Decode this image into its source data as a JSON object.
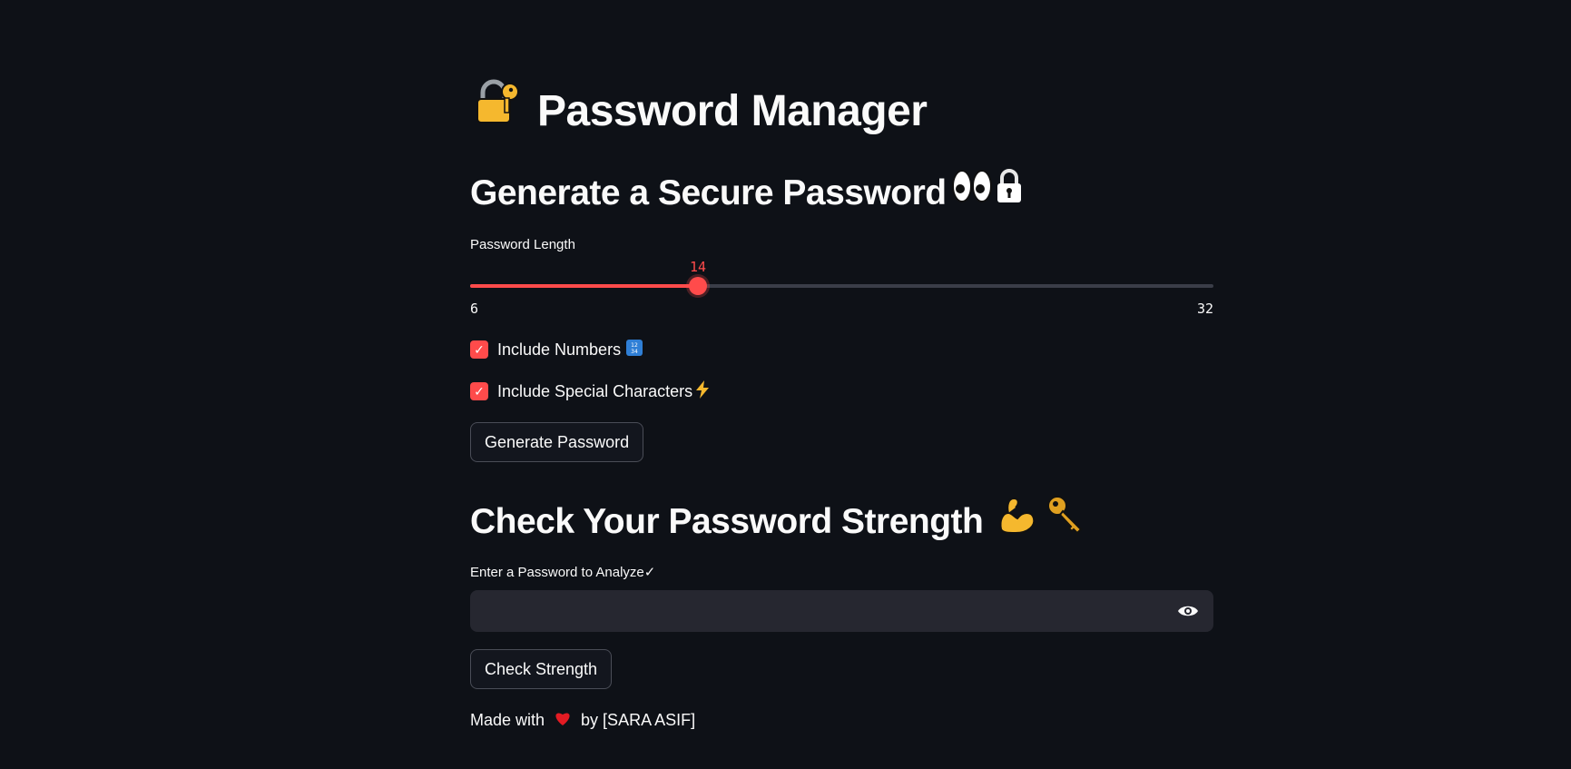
{
  "app": {
    "title": "Password Manager",
    "title_icon": "locked-with-key-icon"
  },
  "generator": {
    "heading": "Generate a Secure Password",
    "heading_icons": [
      "eyes-icon",
      "padlock-icon"
    ],
    "length_label": "Password Length",
    "length": {
      "min": "6",
      "max": "32",
      "value": "14"
    },
    "include_numbers": {
      "label": "Include Numbers",
      "icon": "numbers-keycap-icon",
      "checked": true
    },
    "include_special": {
      "label": "Include Special Characters",
      "icon": "lightning-icon",
      "checked": true
    },
    "button_label": "Generate Password"
  },
  "checker": {
    "heading": "Check Your Password Strength",
    "heading_icons": [
      "flexed-biceps-icon",
      "key-icon"
    ],
    "input_label": "Enter a Password to Analyze✓",
    "input_value": "",
    "input_placeholder": "",
    "toggle_icon": "eye-icon",
    "button_label": "Check Strength"
  },
  "footer": {
    "prefix": "Made with",
    "icon": "heart-icon",
    "suffix": "by [SARA ASIF]"
  },
  "colors": {
    "background": "#0e1117",
    "accent": "#ff4b4b",
    "text": "#fafafa",
    "input_bg": "#262730"
  }
}
